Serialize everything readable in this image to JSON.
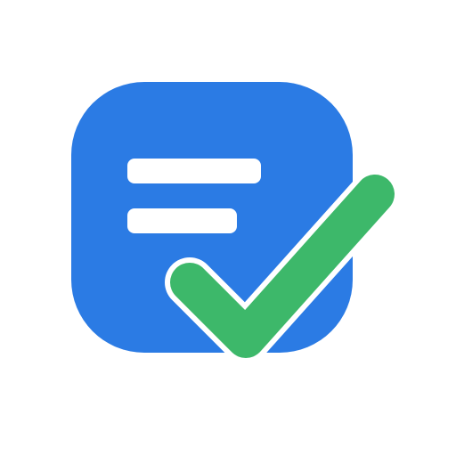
{
  "icon": {
    "name": "task-list-check-icon",
    "colors": {
      "tile": "#2B7BE4",
      "text_lines": "#FFFFFF",
      "check_fill": "#3DB86A",
      "check_outline": "#FFFFFF",
      "background": "#FFFFFF"
    }
  }
}
